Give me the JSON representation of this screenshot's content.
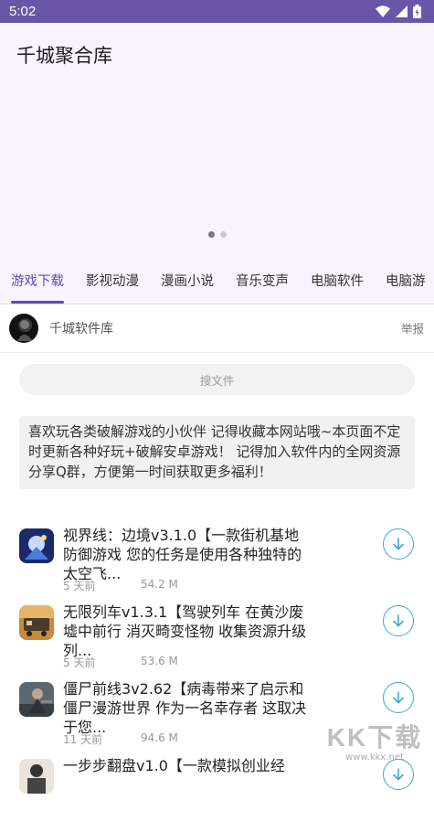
{
  "status_bar": {
    "time": "5:02",
    "icons": [
      "wifi-icon",
      "signal-icon",
      "battery-icon"
    ]
  },
  "header": {
    "title": "千城聚合库",
    "pager": {
      "count": 2,
      "active_index": 0
    }
  },
  "tabs": [
    {
      "label": "游戏下载",
      "active": true
    },
    {
      "label": "影视动漫",
      "active": false
    },
    {
      "label": "漫画小说",
      "active": false
    },
    {
      "label": "音乐变声",
      "active": false
    },
    {
      "label": "电脑软件",
      "active": false
    },
    {
      "label": "电脑游",
      "active": false
    }
  ],
  "author": {
    "name": "千城软件库",
    "report_label": "举报"
  },
  "search": {
    "placeholder": "搜文件"
  },
  "notice": {
    "text": "喜欢玩各类破解游戏的小伙伴 记得收藏本网站哦~本页面不定时更新各种好玩+破解安卓游戏！ 记得加入软件内的全网资源分享Q群，方便第一时间获取更多福利！"
  },
  "items": [
    {
      "title": "视界线：边境v3.1.0【一款街机基地防御游戏 您的任务是使用各种独特的太空飞...",
      "date": "5 天前",
      "size": "54.2 M",
      "icon": "space-shooter-game-icon"
    },
    {
      "title": "无限列车v1.3.1【驾驶列车 在黄沙废墟中前行 消灭畸变怪物 收集资源升级列...",
      "date": "5 天前",
      "size": "53.6 M",
      "icon": "train-game-icon"
    },
    {
      "title": "僵尸前线3v2.62【病毒带来了启示和僵尸漫游世界 作为一名幸存者 这取决于您...",
      "date": "11 天前",
      "size": "94.6 M",
      "icon": "zombie-game-icon"
    },
    {
      "title": "一步步翻盘v1.0【一款模拟创业经",
      "date": "",
      "size": "",
      "icon": "business-game-icon"
    }
  ],
  "watermark": {
    "text": "KK下载",
    "url": "www.kkx.net"
  },
  "colors": {
    "status_bar": "#6a55a8",
    "header_bg": "#fbf2ff",
    "accent": "#5f4bb6",
    "download": "#3aa7dd"
  }
}
